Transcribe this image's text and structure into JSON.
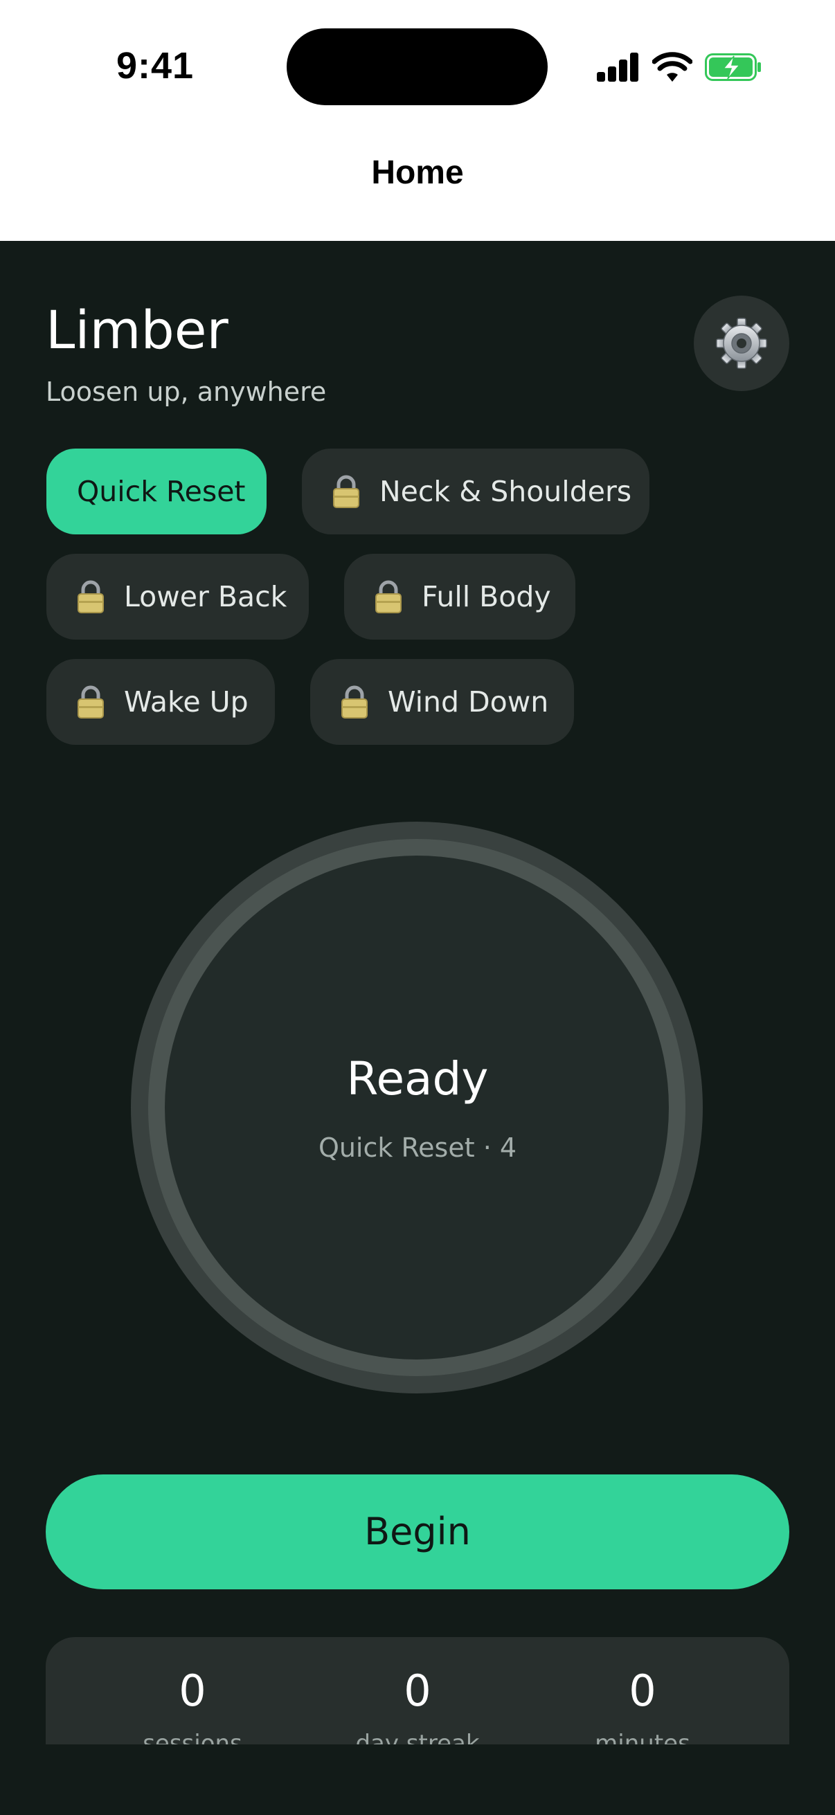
{
  "status_bar": {
    "time": "9:41",
    "icons": [
      "signal-icon",
      "wifi-icon",
      "battery-charging-icon"
    ]
  },
  "nav": {
    "title": "Home"
  },
  "header": {
    "title": "Limber",
    "subtitle": "Loosen up, anywhere",
    "settings_icon": "gear-icon"
  },
  "routines": [
    {
      "label": "Quick Reset",
      "locked": false,
      "selected": true
    },
    {
      "label": "Neck & Shoulders",
      "locked": true,
      "selected": false
    },
    {
      "label": "Lower Back",
      "locked": true,
      "selected": false
    },
    {
      "label": "Full Body",
      "locked": true,
      "selected": false
    },
    {
      "label": "Wake Up",
      "locked": true,
      "selected": false
    },
    {
      "label": "Wind Down",
      "locked": true,
      "selected": false
    }
  ],
  "timer": {
    "status": "Ready",
    "detail": "Quick Reset · 4"
  },
  "begin_label": "Begin",
  "stats": [
    {
      "value": "0",
      "label": "sessions"
    },
    {
      "value": "0",
      "label": "day streak"
    },
    {
      "value": "0",
      "label": "minutes"
    }
  ],
  "colors": {
    "accent": "#33d399",
    "background": "#121b18",
    "surface": "#272e2c",
    "ring": "#4b5451",
    "battery_fill": "#34c759"
  }
}
